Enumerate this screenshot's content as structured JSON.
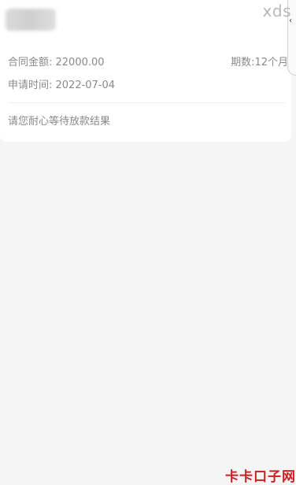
{
  "loan": {
    "contract_amount": "合同金额: 22000.00",
    "term": "期数:12个月",
    "apply_time": "申请时间: 2022-07-04",
    "status_message": "请您耐心等待放款结果"
  },
  "watermark": {
    "top_text": "xds",
    "bottom_text": "卡卡口子网"
  },
  "icons": {
    "edge_handle": "chevron-left-icon"
  }
}
